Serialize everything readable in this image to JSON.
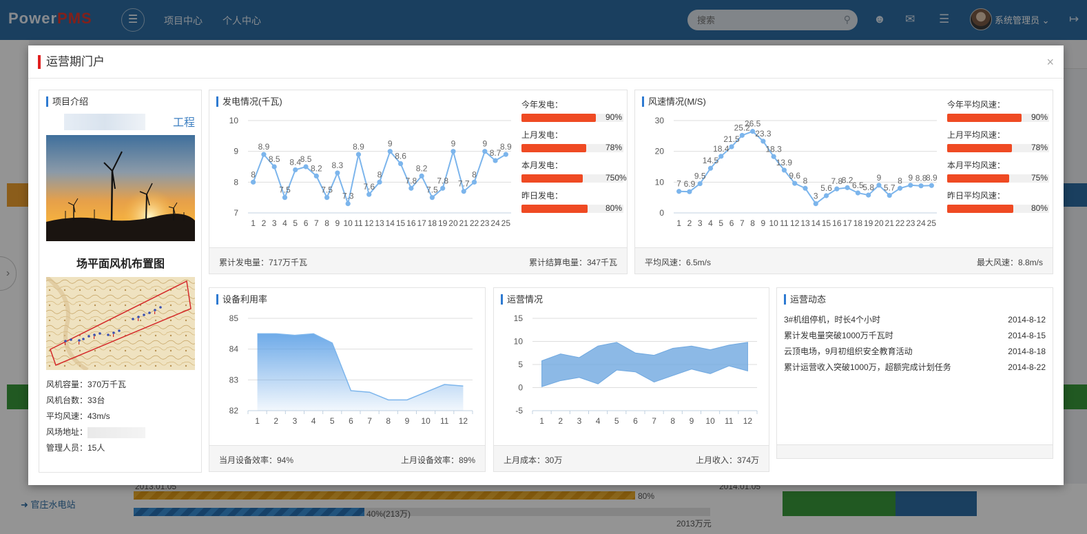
{
  "header": {
    "logo_part1": "Power",
    "logo_part2": "PMS",
    "nav": [
      "项目中心",
      "个人中心"
    ],
    "search_placeholder": "搜索",
    "username": "系统管理员"
  },
  "background": {
    "station_name": "官庄水电站",
    "date_left": "2013.01.05",
    "date_right": "2014.01.05",
    "bar1_label": "80%",
    "bar2_label": "40%(213万)",
    "bar2_right": "2013万元"
  },
  "modal": {
    "title": "运营期门户",
    "close_label": "×"
  },
  "project": {
    "title": "项目介绍",
    "name_visible": "工程",
    "layout_title": "场平面风机布置图",
    "info": {
      "capacity": "风机容量：370万千瓦",
      "count": "风机台数：33台",
      "avg_wind": "平均风速：43m/s",
      "address_label": "风场地址：",
      "staff": "管理人员：15人"
    }
  },
  "power": {
    "title": "发电情况(千瓦)",
    "bars": [
      {
        "label": "今年发电：",
        "pct_text": "90%",
        "value": 0.9
      },
      {
        "label": "上月发电：",
        "pct_text": "78%",
        "value": 0.78
      },
      {
        "label": "本月发电：",
        "pct_text": "750%",
        "value": 0.74
      },
      {
        "label": "昨日发电：",
        "pct_text": "80%",
        "value": 0.8
      }
    ],
    "foot_left": "累计发电量：717万千瓦",
    "foot_right": "累计结算电量：347千瓦"
  },
  "wind": {
    "title": "风速情况(M/S)",
    "bars": [
      {
        "label": "今年平均风速：",
        "pct_text": "90%",
        "value": 0.9
      },
      {
        "label": "上月平均风速：",
        "pct_text": "78%",
        "value": 0.78
      },
      {
        "label": "本月平均风速：",
        "pct_text": "75%",
        "value": 0.75
      },
      {
        "label": "昨日平均风速：",
        "pct_text": "80%",
        "value": 0.8
      }
    ],
    "foot_left": "平均风速：6.5m/s",
    "foot_right": "最大风速：8.8m/s"
  },
  "equipment": {
    "title": "设备利用率",
    "foot_left": "当月设备效率：94%",
    "foot_right": "上月设备效率：89%"
  },
  "operation": {
    "title": "运营情况",
    "foot_left": "上月成本：30万",
    "foot_right": "上月收入：374万"
  },
  "dynamics": {
    "title": "运营动态",
    "items": [
      {
        "text": "3#机组停机，时长4个小时",
        "date": "2014-8-12"
      },
      {
        "text": "累计发电量突破1000万千瓦时",
        "date": "2014-8-15"
      },
      {
        "text": "云顶电场，9月初组织安全教育活动",
        "date": "2014-8-18"
      },
      {
        "text": "累计运营收入突破1000万，超额完成计划任务",
        "date": "2014-8-22"
      }
    ]
  },
  "chart_data": [
    {
      "type": "line",
      "name": "power",
      "x": [
        1,
        2,
        3,
        4,
        5,
        6,
        7,
        8,
        9,
        10,
        11,
        12,
        13,
        14,
        15,
        16,
        17,
        18,
        19,
        20,
        21,
        22,
        23,
        24,
        25
      ],
      "values": [
        8,
        8.9,
        8.5,
        7.5,
        8.4,
        8.5,
        8.2,
        7.5,
        8.3,
        7.3,
        8.9,
        7.6,
        8,
        9,
        8.6,
        7.8,
        8.2,
        7.5,
        7.8,
        9,
        7.7,
        8,
        9,
        8.7,
        8.9
      ],
      "ylim": [
        7,
        10
      ],
      "yticks": [
        7,
        8,
        9,
        10
      ],
      "color": "#7cb5ec"
    },
    {
      "type": "line",
      "name": "wind",
      "x": [
        1,
        2,
        3,
        4,
        5,
        6,
        7,
        8,
        9,
        10,
        11,
        12,
        13,
        14,
        15,
        16,
        17,
        18,
        19,
        20,
        21,
        22,
        23,
        24,
        25
      ],
      "values": [
        7,
        6.9,
        9.5,
        14.5,
        18.4,
        21.5,
        25.2,
        26.5,
        23.3,
        18.3,
        13.9,
        9.6,
        8,
        3,
        5.6,
        7.8,
        8.2,
        6.5,
        5.8,
        9,
        5.7,
        8,
        9,
        8.8,
        8.9
      ],
      "ylim": [
        0,
        30
      ],
      "yticks": [
        0,
        10,
        20,
        30
      ],
      "color": "#7cb5ec"
    },
    {
      "type": "area",
      "name": "equipment",
      "x": [
        1,
        2,
        3,
        4,
        5,
        6,
        7,
        8,
        9,
        10,
        11,
        12
      ],
      "values": [
        84.5,
        84.5,
        84.45,
        84.5,
        84.2,
        82.65,
        82.6,
        82.35,
        82.35,
        82.6,
        82.85,
        82.8
      ],
      "ylim": [
        82,
        85
      ],
      "yticks": [
        82,
        83,
        84,
        85
      ],
      "color": "#7cb5ec"
    },
    {
      "type": "area",
      "name": "operation",
      "x": [
        1,
        2,
        3,
        4,
        5,
        6,
        7,
        8,
        9,
        10,
        11,
        12
      ],
      "low": [
        0.2,
        1.5,
        2.2,
        0.8,
        3.8,
        3.4,
        1.2,
        2.6,
        4.0,
        3.0,
        4.7,
        3.6
      ],
      "high": [
        5.8,
        7.3,
        6.5,
        9.0,
        9.8,
        7.5,
        7.0,
        8.5,
        9.0,
        8.2,
        9.2,
        9.8
      ],
      "ylim": [
        -5,
        15
      ],
      "yticks": [
        -5,
        0,
        5,
        10,
        15
      ],
      "color": "#6fa8e0"
    }
  ]
}
